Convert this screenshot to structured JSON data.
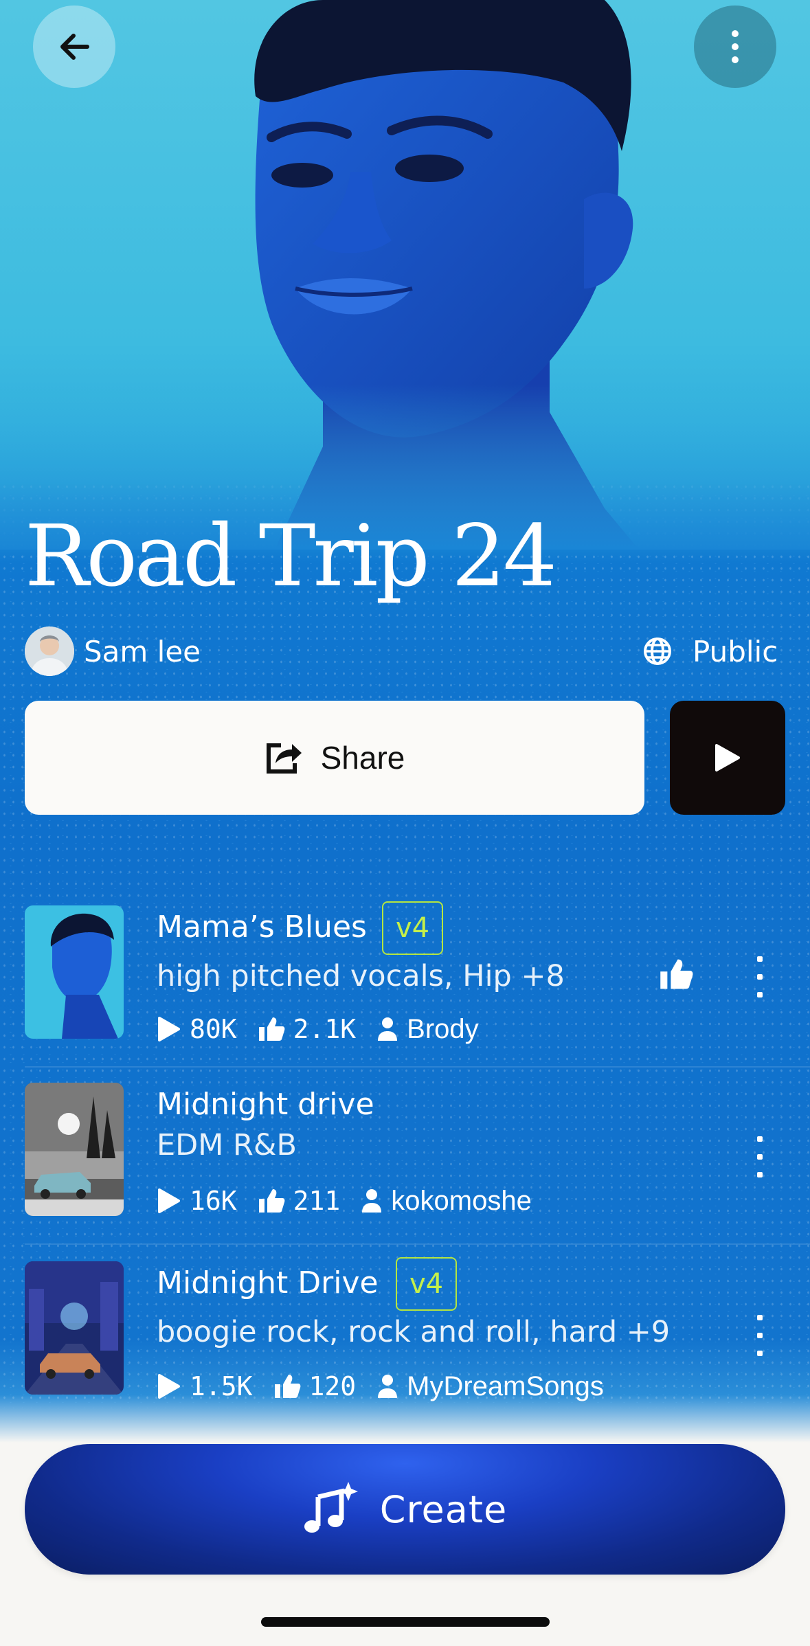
{
  "playlist": {
    "title": "Road Trip 24",
    "owner": "Sam lee",
    "visibility": "Public",
    "share_label": "Share"
  },
  "songs": [
    {
      "title": "Mama’s Blues",
      "badge": "v4",
      "tags": "high pitched vocals, Hip +8",
      "plays": "80K",
      "likes": "2.1K",
      "user": "Brody",
      "liked": true
    },
    {
      "title": "Midnight drive",
      "badge": "",
      "tags": "EDM R&B",
      "plays": "16K",
      "likes": "211",
      "user": "kokomoshe",
      "liked": false
    },
    {
      "title": "Midnight Drive",
      "badge": "v4",
      "tags": "boogie rock, rock and roll, hard +9",
      "plays": "1.5K",
      "likes": "120",
      "user": "MyDreamSongs",
      "liked": false
    }
  ],
  "create_label": "Create",
  "icons": {
    "back": "arrow-left-icon",
    "more": "more-vertical-icon",
    "visibility": "globe-icon",
    "share": "share-icon",
    "play": "play-icon",
    "like": "thumbs-up-icon",
    "user": "person-icon",
    "create": "music-sparkle-icon"
  },
  "colors": {
    "accent_badge": "#c5f04a",
    "create_button": "#1a3fc4",
    "play_button": "#100a0a"
  }
}
